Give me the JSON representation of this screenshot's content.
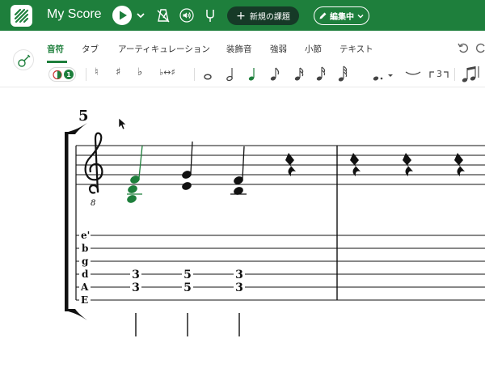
{
  "app": {
    "title": "My Score"
  },
  "header": {
    "new_label": "新規の課題",
    "edit_label": "編集中"
  },
  "tabs": [
    {
      "label": "音符"
    },
    {
      "label": "タブ"
    },
    {
      "label": "アーティキュレーション"
    },
    {
      "label": "装飾音"
    },
    {
      "label": "強弱"
    },
    {
      "label": "小節"
    },
    {
      "label": "テキスト"
    }
  ],
  "tools": {
    "voice_number": "1",
    "natural": "♮",
    "sharp": "♯",
    "flat": "♭",
    "enharmonic": "♭↔♯",
    "tuplet": "3"
  },
  "score": {
    "measure_number": "5",
    "tab_strings": [
      "e'",
      "b",
      "g",
      "d",
      "A",
      "E"
    ],
    "tab_frets": [
      {
        "d": "3",
        "A": "3"
      },
      {
        "d": "5",
        "A": "5"
      },
      {
        "d": "3",
        "A": "3"
      }
    ],
    "treble_octave": "8"
  },
  "colors": {
    "brand": "#1e7f3c",
    "new_button": "#163a27",
    "selected_note": "#1e7f3c",
    "ink": "#111111"
  }
}
